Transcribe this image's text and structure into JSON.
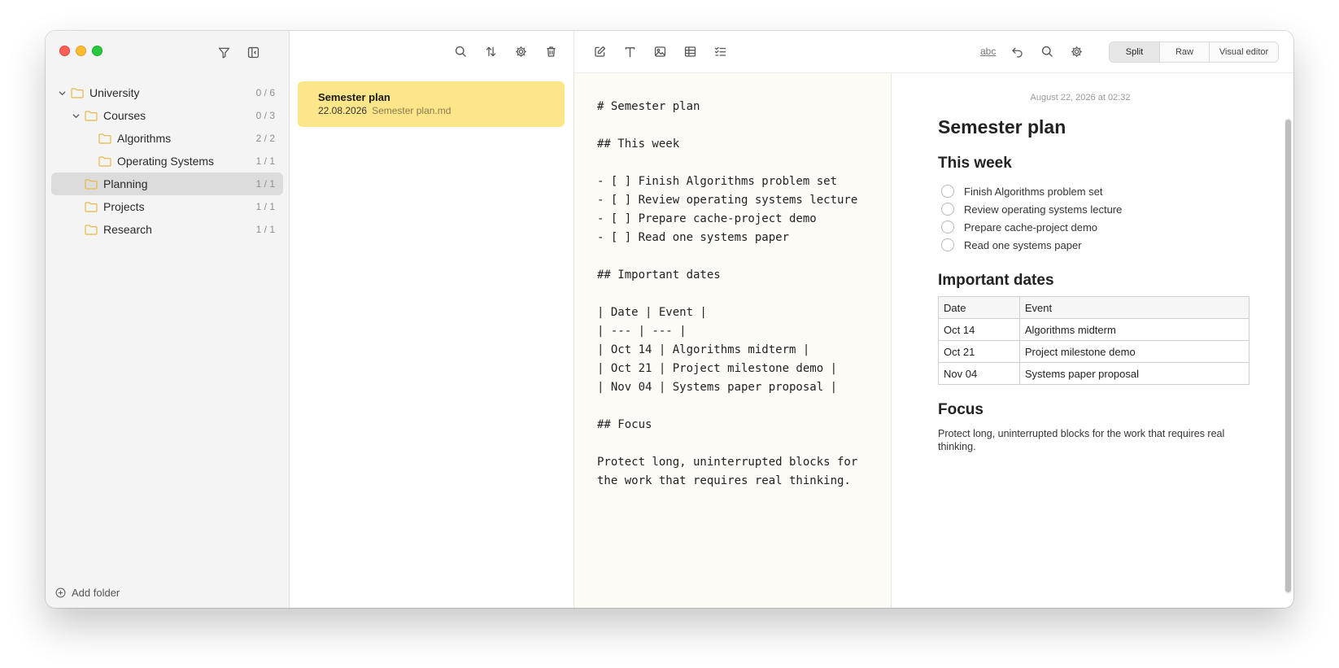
{
  "sidebar": {
    "tree": [
      {
        "label": "University",
        "count": "0 / 6",
        "depth": 0,
        "expanded": true
      },
      {
        "label": "Courses",
        "count": "0 / 3",
        "depth": 1,
        "expanded": true
      },
      {
        "label": "Algorithms",
        "count": "2 / 2",
        "depth": 2
      },
      {
        "label": "Operating Systems",
        "count": "1 / 1",
        "depth": 2
      },
      {
        "label": "Planning",
        "count": "1 / 1",
        "depth": 1,
        "selected": true
      },
      {
        "label": "Projects",
        "count": "1 / 1",
        "depth": 1
      },
      {
        "label": "Research",
        "count": "1 / 1",
        "depth": 1
      }
    ],
    "add_folder_label": "Add folder"
  },
  "notes": {
    "items": [
      {
        "title": "Semester plan",
        "date": "22.08.2026",
        "filename": "Semester plan.md"
      }
    ]
  },
  "toolbar": {
    "spellcheck_label": "abc",
    "modes": [
      {
        "label": "Split",
        "active": true
      },
      {
        "label": "Raw",
        "active": false
      },
      {
        "label": "Visual editor",
        "active": false
      }
    ]
  },
  "raw": {
    "text": "# Semester plan\n\n## This week\n\n- [ ] Finish Algorithms problem set\n- [ ] Review operating systems lecture\n- [ ] Prepare cache-project demo\n- [ ] Read one systems paper\n\n## Important dates\n\n| Date | Event |\n| --- | --- |\n| Oct 14 | Algorithms midterm |\n| Oct 21 | Project milestone demo |\n| Nov 04 | Systems paper proposal |\n\n## Focus\n\nProtect long, uninterrupted blocks for\nthe work that requires real thinking."
  },
  "preview": {
    "date": "August 22, 2026 at 02:32",
    "title": "Semester plan",
    "this_week_heading": "This week",
    "tasks": [
      "Finish Algorithms problem set",
      "Review operating systems lecture",
      "Prepare cache-project demo",
      "Read one systems paper"
    ],
    "dates_heading": "Important dates",
    "table": {
      "headers": [
        "Date",
        "Event"
      ],
      "rows": [
        [
          "Oct 14",
          "Algorithms midterm"
        ],
        [
          "Oct 21",
          "Project milestone demo"
        ],
        [
          "Nov 04",
          "Systems paper proposal"
        ]
      ]
    },
    "focus_heading": "Focus",
    "focus_text": "Protect long, uninterrupted blocks for the work that requires real thinking."
  },
  "colors": {
    "note_card": "#fde68a",
    "folder": "#e8b84a",
    "close": "#fe5f57",
    "minimize": "#febc2e",
    "maximize": "#28c840"
  }
}
